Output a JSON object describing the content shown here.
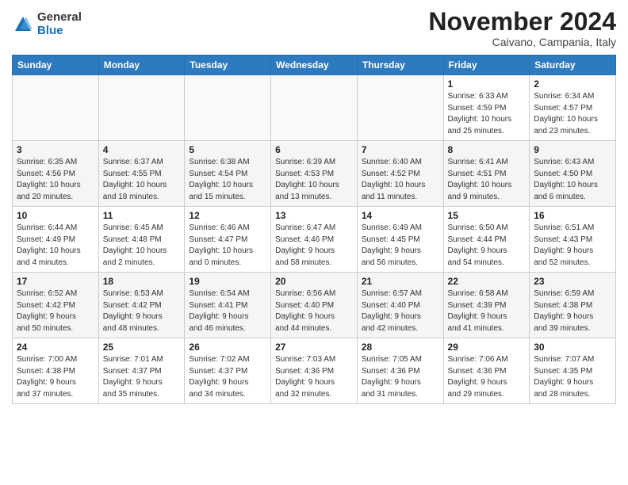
{
  "header": {
    "logo_general": "General",
    "logo_blue": "Blue",
    "month_title": "November 2024",
    "location": "Caivano, Campania, Italy"
  },
  "weekdays": [
    "Sunday",
    "Monday",
    "Tuesday",
    "Wednesday",
    "Thursday",
    "Friday",
    "Saturday"
  ],
  "weeks": [
    [
      {
        "day": "",
        "info": ""
      },
      {
        "day": "",
        "info": ""
      },
      {
        "day": "",
        "info": ""
      },
      {
        "day": "",
        "info": ""
      },
      {
        "day": "",
        "info": ""
      },
      {
        "day": "1",
        "info": "Sunrise: 6:33 AM\nSunset: 4:59 PM\nDaylight: 10 hours\nand 25 minutes."
      },
      {
        "day": "2",
        "info": "Sunrise: 6:34 AM\nSunset: 4:57 PM\nDaylight: 10 hours\nand 23 minutes."
      }
    ],
    [
      {
        "day": "3",
        "info": "Sunrise: 6:35 AM\nSunset: 4:56 PM\nDaylight: 10 hours\nand 20 minutes."
      },
      {
        "day": "4",
        "info": "Sunrise: 6:37 AM\nSunset: 4:55 PM\nDaylight: 10 hours\nand 18 minutes."
      },
      {
        "day": "5",
        "info": "Sunrise: 6:38 AM\nSunset: 4:54 PM\nDaylight: 10 hours\nand 15 minutes."
      },
      {
        "day": "6",
        "info": "Sunrise: 6:39 AM\nSunset: 4:53 PM\nDaylight: 10 hours\nand 13 minutes."
      },
      {
        "day": "7",
        "info": "Sunrise: 6:40 AM\nSunset: 4:52 PM\nDaylight: 10 hours\nand 11 minutes."
      },
      {
        "day": "8",
        "info": "Sunrise: 6:41 AM\nSunset: 4:51 PM\nDaylight: 10 hours\nand 9 minutes."
      },
      {
        "day": "9",
        "info": "Sunrise: 6:43 AM\nSunset: 4:50 PM\nDaylight: 10 hours\nand 6 minutes."
      }
    ],
    [
      {
        "day": "10",
        "info": "Sunrise: 6:44 AM\nSunset: 4:49 PM\nDaylight: 10 hours\nand 4 minutes."
      },
      {
        "day": "11",
        "info": "Sunrise: 6:45 AM\nSunset: 4:48 PM\nDaylight: 10 hours\nand 2 minutes."
      },
      {
        "day": "12",
        "info": "Sunrise: 6:46 AM\nSunset: 4:47 PM\nDaylight: 10 hours\nand 0 minutes."
      },
      {
        "day": "13",
        "info": "Sunrise: 6:47 AM\nSunset: 4:46 PM\nDaylight: 9 hours\nand 58 minutes."
      },
      {
        "day": "14",
        "info": "Sunrise: 6:49 AM\nSunset: 4:45 PM\nDaylight: 9 hours\nand 56 minutes."
      },
      {
        "day": "15",
        "info": "Sunrise: 6:50 AM\nSunset: 4:44 PM\nDaylight: 9 hours\nand 54 minutes."
      },
      {
        "day": "16",
        "info": "Sunrise: 6:51 AM\nSunset: 4:43 PM\nDaylight: 9 hours\nand 52 minutes."
      }
    ],
    [
      {
        "day": "17",
        "info": "Sunrise: 6:52 AM\nSunset: 4:42 PM\nDaylight: 9 hours\nand 50 minutes."
      },
      {
        "day": "18",
        "info": "Sunrise: 6:53 AM\nSunset: 4:42 PM\nDaylight: 9 hours\nand 48 minutes."
      },
      {
        "day": "19",
        "info": "Sunrise: 6:54 AM\nSunset: 4:41 PM\nDaylight: 9 hours\nand 46 minutes."
      },
      {
        "day": "20",
        "info": "Sunrise: 6:56 AM\nSunset: 4:40 PM\nDaylight: 9 hours\nand 44 minutes."
      },
      {
        "day": "21",
        "info": "Sunrise: 6:57 AM\nSunset: 4:40 PM\nDaylight: 9 hours\nand 42 minutes."
      },
      {
        "day": "22",
        "info": "Sunrise: 6:58 AM\nSunset: 4:39 PM\nDaylight: 9 hours\nand 41 minutes."
      },
      {
        "day": "23",
        "info": "Sunrise: 6:59 AM\nSunset: 4:38 PM\nDaylight: 9 hours\nand 39 minutes."
      }
    ],
    [
      {
        "day": "24",
        "info": "Sunrise: 7:00 AM\nSunset: 4:38 PM\nDaylight: 9 hours\nand 37 minutes."
      },
      {
        "day": "25",
        "info": "Sunrise: 7:01 AM\nSunset: 4:37 PM\nDaylight: 9 hours\nand 35 minutes."
      },
      {
        "day": "26",
        "info": "Sunrise: 7:02 AM\nSunset: 4:37 PM\nDaylight: 9 hours\nand 34 minutes."
      },
      {
        "day": "27",
        "info": "Sunrise: 7:03 AM\nSunset: 4:36 PM\nDaylight: 9 hours\nand 32 minutes."
      },
      {
        "day": "28",
        "info": "Sunrise: 7:05 AM\nSunset: 4:36 PM\nDaylight: 9 hours\nand 31 minutes."
      },
      {
        "day": "29",
        "info": "Sunrise: 7:06 AM\nSunset: 4:36 PM\nDaylight: 9 hours\nand 29 minutes."
      },
      {
        "day": "30",
        "info": "Sunrise: 7:07 AM\nSunset: 4:35 PM\nDaylight: 9 hours\nand 28 minutes."
      }
    ]
  ]
}
